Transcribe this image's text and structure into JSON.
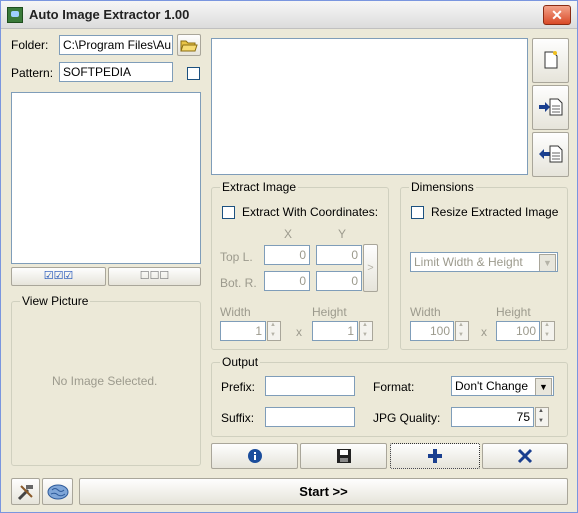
{
  "window": {
    "title": "Auto Image Extractor 1.00",
    "close_label": "✕"
  },
  "folder": {
    "label": "Folder:",
    "value": "C:\\Program Files\\Au"
  },
  "pattern": {
    "label": "Pattern:",
    "value": "SOFTPEDIA"
  },
  "select_buttons": {
    "check_all": "☑☑☑",
    "uncheck_all": "☐☐☐"
  },
  "view_picture": {
    "title": "View Picture",
    "empty_text": "No Image Selected."
  },
  "extract_image": {
    "title": "Extract Image",
    "with_coordinates_label": "Extract With Coordinates:",
    "x_header": "X",
    "y_header": "Y",
    "top_left_label": "Top L.",
    "bottom_right_label": "Bot. R.",
    "top_left_x": "0",
    "top_left_y": "0",
    "bottom_right_x": "0",
    "bottom_right_y": "0",
    "width_label": "Width",
    "height_label": "Height",
    "width_value": "1",
    "height_value": "1",
    "times": "x"
  },
  "dimensions": {
    "title": "Dimensions",
    "resize_label": "Resize Extracted Image",
    "mode_selected": "Limit Width & Height",
    "width_label": "Width",
    "height_label": "Height",
    "width_value": "100",
    "height_value": "100",
    "times": "x"
  },
  "output": {
    "title": "Output",
    "prefix_label": "Prefix:",
    "prefix_value": "",
    "suffix_label": "Suffix:",
    "suffix_value": "",
    "format_label": "Format:",
    "format_selected": "Don't Change",
    "jpg_quality_label": "JPG Quality:",
    "jpg_quality_value": "75"
  },
  "start_label": "Start >>",
  "colors": {
    "info_icon": "#1b4d9c",
    "accent_arrow": "#1a3f8f"
  }
}
